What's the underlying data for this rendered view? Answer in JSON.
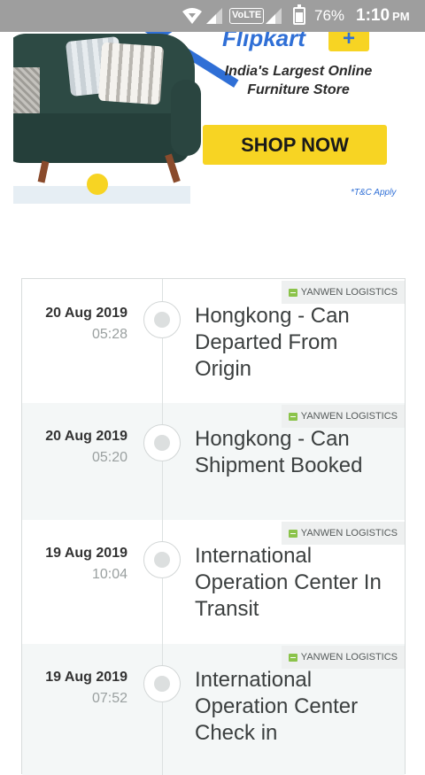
{
  "status_bar": {
    "volte": "VoLTE",
    "battery": "76%",
    "time": "1:10",
    "ampm": "PM"
  },
  "ad": {
    "brand": "Flipkart",
    "brand_plus": "+",
    "tagline": "India's Largest Online Furniture Store",
    "cta": "SHOP NOW",
    "disclaimer": "*T&C Apply",
    "colors": {
      "cta": "#f7d423",
      "brand": "#2f6fd6"
    }
  },
  "tracking": {
    "events": [
      {
        "carrier": "YANWEN LOGISTICS",
        "date": "20 Aug 2019",
        "time": "05:28",
        "status": "Hongkong - Can Departed From Origin"
      },
      {
        "carrier": "YANWEN LOGISTICS",
        "date": "20 Aug 2019",
        "time": "05:20",
        "status": "Hongkong - Can Shipment Booked"
      },
      {
        "carrier": "YANWEN LOGISTICS",
        "date": "19 Aug 2019",
        "time": "10:04",
        "status": "International Operation Center In Transit"
      },
      {
        "carrier": "YANWEN LOGISTICS",
        "date": "19 Aug 2019",
        "time": "07:52",
        "status": "International Operation Center Check in"
      }
    ]
  }
}
